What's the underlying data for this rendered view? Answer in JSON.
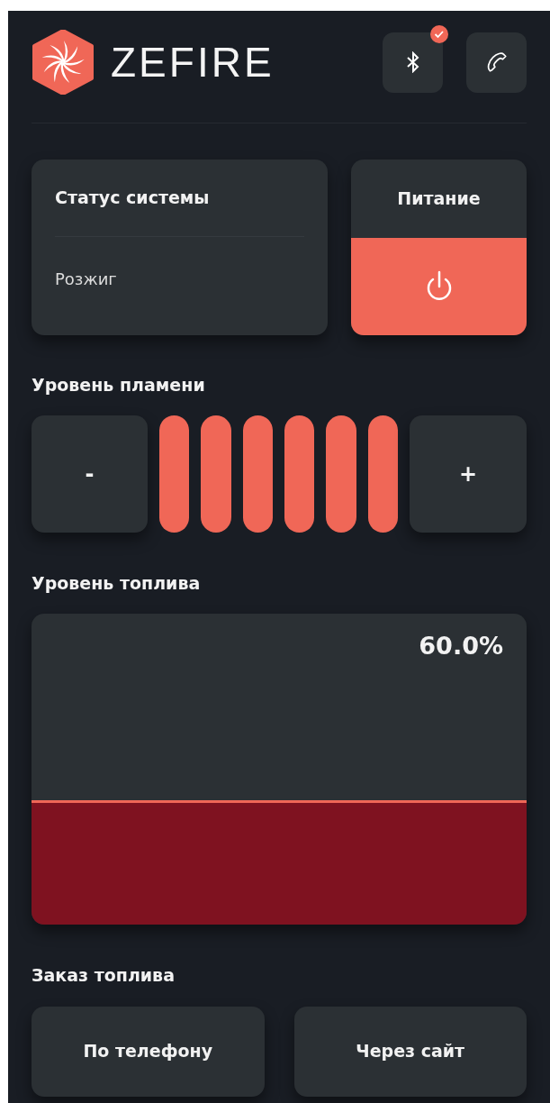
{
  "header": {
    "logo": "ZEFIRE",
    "bluetooth": {
      "connected": true
    }
  },
  "status_card": {
    "title": "Статус системы",
    "value": "Розжиг"
  },
  "power_card": {
    "title": "Питание",
    "on": true
  },
  "flame": {
    "label": "Уровень пламени",
    "minus": "-",
    "plus": "+",
    "bars": [
      {
        "on": true
      },
      {
        "on": true
      },
      {
        "on": true
      },
      {
        "on": true
      },
      {
        "on": true
      },
      {
        "on": true
      }
    ]
  },
  "fuel": {
    "label": "Уровень топлива",
    "reading": "60.0%"
  },
  "order": {
    "label": "Заказ топлива",
    "buttons": [
      "По телефону",
      "Через сайт"
    ]
  }
}
